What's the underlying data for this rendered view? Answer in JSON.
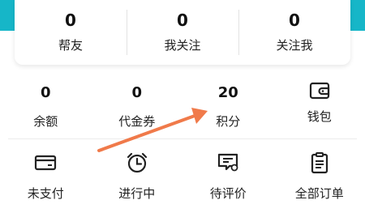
{
  "social": [
    {
      "value": "0",
      "label": "帮友"
    },
    {
      "value": "0",
      "label": "我关注"
    },
    {
      "value": "0",
      "label": "关注我"
    }
  ],
  "assets": [
    {
      "value": "0",
      "label": "余额"
    },
    {
      "value": "0",
      "label": "代金券"
    },
    {
      "value": "20",
      "label": "积分"
    },
    {
      "label": "钱包",
      "icon": "wallet-icon"
    }
  ],
  "orders": [
    {
      "label": "未支付",
      "icon": "card-icon"
    },
    {
      "label": "进行中",
      "icon": "alarm-clock-icon"
    },
    {
      "label": "待评价",
      "icon": "review-icon"
    },
    {
      "label": "全部订单",
      "icon": "clipboard-icon"
    }
  ],
  "colors": {
    "accent_teal": "#16b6c8",
    "annotation_arrow": "#f07a4a"
  }
}
